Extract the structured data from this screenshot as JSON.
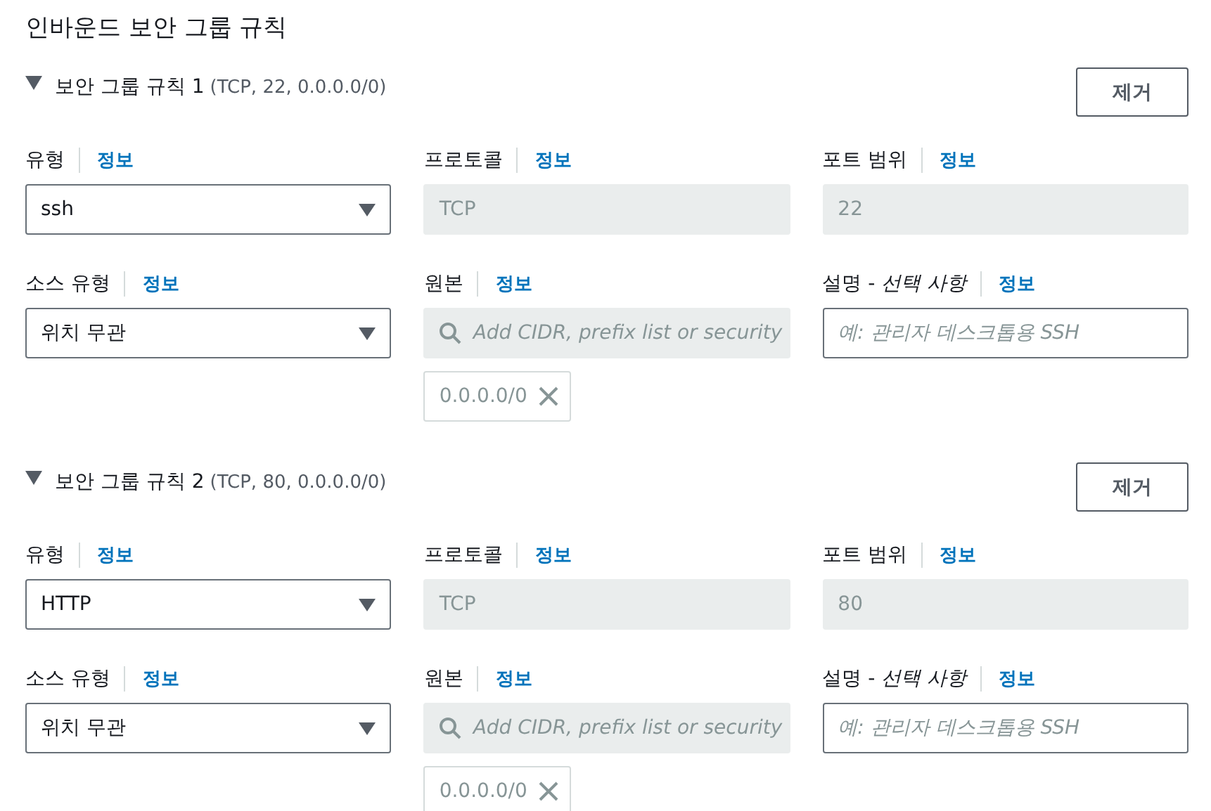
{
  "heading": "인바운드 보안 그룹 규칙",
  "rules": [
    {
      "expanded": true,
      "title": "보안 그룹 규칙 1",
      "summary": "(TCP, 22, 0.0.0.0/0)",
      "remove_button": "제거",
      "fields": [
        {
          "kind": "select",
          "label": "유형",
          "info": "정보",
          "value": "ssh"
        },
        {
          "kind": "readonly",
          "label": "프로토콜",
          "info": "정보",
          "value": "TCP"
        },
        {
          "kind": "readonly",
          "label": "포트 범위",
          "info": "정보",
          "value": "22"
        },
        {
          "kind": "select",
          "label": "소스 유형",
          "info": "정보",
          "value": "위치 무관"
        },
        {
          "kind": "search",
          "label": "원본",
          "info": "정보",
          "placeholder": "Add CIDR, prefix list or security",
          "tokens": [
            "0.0.0.0/0"
          ]
        },
        {
          "kind": "text",
          "label": "설명 - *선택 사항*",
          "info": "정보",
          "placeholder": "예: 관리자 데스크톱용 SSH"
        }
      ]
    },
    {
      "expanded": true,
      "title": "보안 그룹 규칙 2",
      "summary": "(TCP, 80, 0.0.0.0/0)",
      "remove_button": "제거",
      "fields": [
        {
          "kind": "select",
          "label": "유형",
          "info": "정보",
          "value": "HTTP"
        },
        {
          "kind": "readonly",
          "label": "프로토콜",
          "info": "정보",
          "value": "TCP"
        },
        {
          "kind": "readonly",
          "label": "포트 범위",
          "info": "정보",
          "value": "80"
        },
        {
          "kind": "select",
          "label": "소스 유형",
          "info": "정보",
          "value": "위치 무관"
        },
        {
          "kind": "search",
          "label": "원본",
          "info": "정보",
          "placeholder": "Add CIDR, prefix list or security",
          "tokens": [
            "0.0.0.0/0"
          ]
        },
        {
          "kind": "text",
          "label": "설명 - *선택 사항*",
          "info": "정보",
          "placeholder": "예: 관리자 데스크톱용 SSH"
        }
      ]
    }
  ]
}
